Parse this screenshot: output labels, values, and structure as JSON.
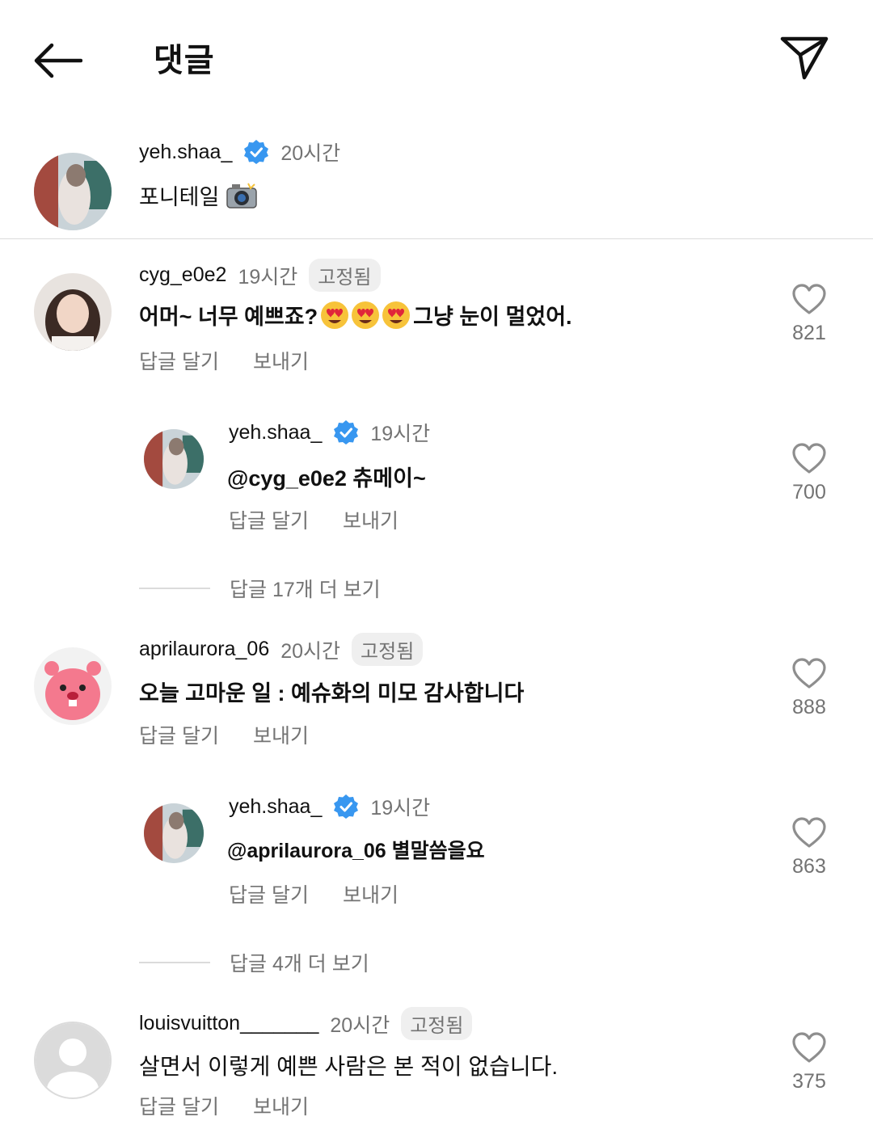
{
  "header": {
    "title": "댓글",
    "back_icon": "arrow-left-icon",
    "send_icon": "paper-plane-icon"
  },
  "caption": {
    "username": "yeh.shaa_",
    "time": "20시간",
    "text": "포니테일",
    "emoji_icon": "camera-flash-icon"
  },
  "comments": [
    {
      "username": "cyg_e0e2",
      "time": "19시간",
      "pinned": "고정됨",
      "text_before": "어머~ 너무 예쁘죠?",
      "text_after": "그냥 눈이 멀었어.",
      "emoji": "heart-eyes-face-icon",
      "likes": "821",
      "reply_label": "답글 달기",
      "send_label": "보내기",
      "reply": {
        "username": "yeh.shaa_",
        "time": "19시간",
        "text": "@cyg_e0e2 츄메이~",
        "likes": "700",
        "reply_label": "답글 달기",
        "send_label": "보내기"
      },
      "more_replies": "답글 17개 더 보기"
    },
    {
      "username": "aprilaurora_06",
      "time": "20시간",
      "pinned": "고정됨",
      "text": "오늘 고마운 일 : 예슈화의 미모 감사합니다",
      "likes": "888",
      "reply_label": "답글 달기",
      "send_label": "보내기",
      "reply": {
        "username": "yeh.shaa_",
        "time": "19시간",
        "text": "@aprilaurora_06 별말씀을요",
        "likes": "863",
        "reply_label": "답글 달기",
        "send_label": "보내기"
      },
      "more_replies": "답글 4개 더 보기"
    },
    {
      "username": "louisvuitton_______",
      "time": "20시간",
      "pinned": "고정됨",
      "text": "살면서 이렇게 예쁜 사람은 본 적이 없습니다.",
      "likes": "375",
      "reply_label": "답글 달기",
      "send_label": "보내기"
    }
  ],
  "colors": {
    "verified": "#3897f0",
    "secondary_text": "#737373",
    "pin_bg": "#efefef",
    "divider": "#dbdbdb"
  }
}
